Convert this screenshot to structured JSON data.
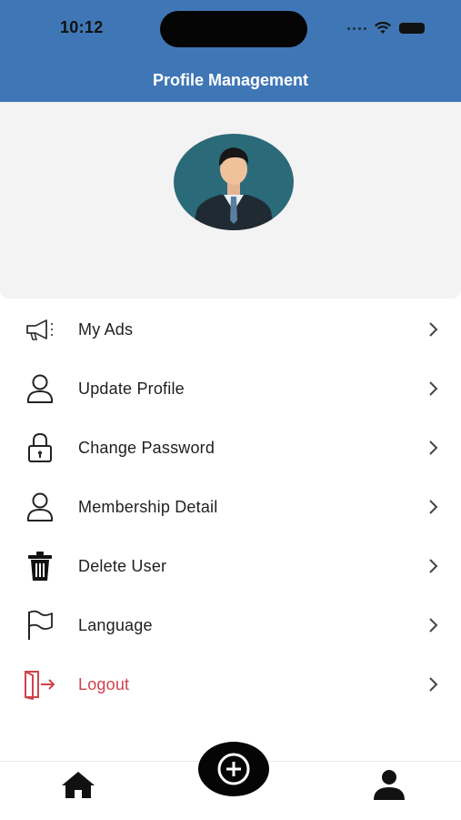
{
  "status": {
    "time": "10:12"
  },
  "header": {
    "title": "Profile Management"
  },
  "menu": {
    "items": [
      {
        "label": "My Ads",
        "icon": "megaphone-icon"
      },
      {
        "label": "Update Profile",
        "icon": "user-icon"
      },
      {
        "label": "Change Password",
        "icon": "lock-icon"
      },
      {
        "label": "Membership Detail",
        "icon": "user-icon"
      },
      {
        "label": "Delete User",
        "icon": "trash-icon"
      },
      {
        "label": "Language",
        "icon": "flag-icon"
      },
      {
        "label": "Logout",
        "icon": "logout-icon",
        "color": "#d0424c"
      }
    ]
  },
  "bottom_nav": {
    "home": "home-icon",
    "add": "add-icon",
    "profile": "profile-icon"
  },
  "colors": {
    "header": "#3f77b6",
    "logout": "#d0424c",
    "avatar_bg": "#2b6a78"
  }
}
